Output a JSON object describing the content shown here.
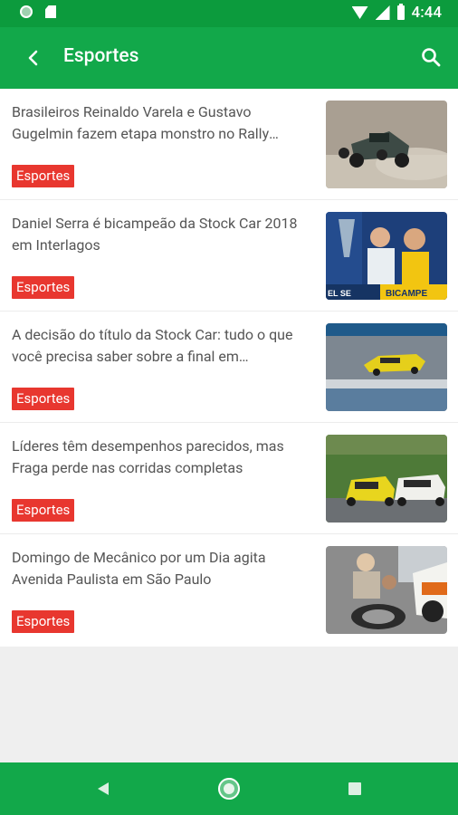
{
  "status_bar": {
    "time": "4:44"
  },
  "app_bar": {
    "title": "Esportes"
  },
  "articles": [
    {
      "headline": "Brasileiros Reinaldo Varela e Gustavo Gugelmin fazem etapa monstro no Rally Dakar",
      "tag": "Esportes"
    },
    {
      "headline": "Daniel Serra é bicampeão da Stock Car 2018 em Interlagos",
      "tag": "Esportes"
    },
    {
      "headline": "A decisão do título da Stock Car: tudo o que você precisa saber sobre a final em Interlagos",
      "tag": "Esportes"
    },
    {
      "headline": "Líderes têm desempenhos parecidos, mas Fraga perde nas corridas completas",
      "tag": "Esportes"
    },
    {
      "headline": "Domingo de Mecânico por um Dia agita Avenida Paulista em São Paulo",
      "tag": "Esportes"
    }
  ],
  "thumbnail_text": {
    "article_1_banner": "BICAMPE",
    "article_1_banner_left": "EL SE"
  },
  "colors": {
    "status_bar": "#0c9b3d",
    "app_bar": "#12a84a",
    "tag": "#e8372f",
    "headline": "#555555"
  }
}
